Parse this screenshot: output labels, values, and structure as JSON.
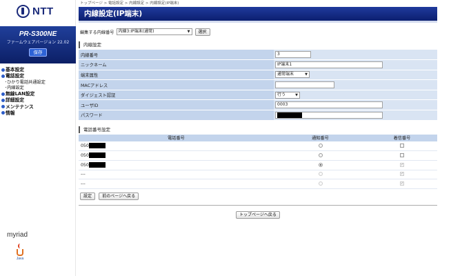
{
  "sidebar": {
    "logo_text": "NTT",
    "model_name": "PR-S300NE",
    "firmware_label": "ファームウェアバージョン",
    "firmware_version": "22.02",
    "save_label": "保存",
    "menu": [
      {
        "label": "基本設定",
        "level": "top"
      },
      {
        "label": "電話設定",
        "level": "top"
      },
      {
        "label": "･ひかり電話共通設定",
        "level": "sub"
      },
      {
        "label": "･内線設定",
        "level": "sub"
      },
      {
        "label": "無線LAN設定",
        "level": "top"
      },
      {
        "label": "詳細設定",
        "level": "top"
      },
      {
        "label": "メンテナンス",
        "level": "top"
      },
      {
        "label": "情報",
        "level": "top"
      }
    ],
    "brand_text": "myriad",
    "java_text": "Java"
  },
  "breadcrumb": "トップページ > 電話設定 > 内線設定 > 内線設定(IP端末)",
  "page_title": "内線設定(IP端末)",
  "extension_select": {
    "label": "編集する内線番号",
    "selected": "内線3:IP端末(通常)",
    "button_label": "選択"
  },
  "extension_section": {
    "title": "内線設定",
    "fields": [
      {
        "label": "内線番号",
        "type": "input",
        "value": "3"
      },
      {
        "label": "ニックネーム",
        "type": "input",
        "value": "IP端末1"
      },
      {
        "label": "端末属性",
        "type": "select",
        "value": "通常端末"
      },
      {
        "label": "MACアドレス",
        "type": "input",
        "value": ""
      },
      {
        "label": "ダイジェスト認証",
        "type": "select",
        "value": "行う"
      },
      {
        "label": "ユーザID",
        "type": "input",
        "value": "0003"
      },
      {
        "label": "パスワード",
        "type": "masked",
        "value": ""
      }
    ]
  },
  "phone_section": {
    "title": "電話番号設定",
    "columns": [
      "電話番号",
      "通知番号",
      "着信番号"
    ],
    "rows": [
      {
        "number": "050",
        "masked": true,
        "notify": "radio-off",
        "incoming": "check-off"
      },
      {
        "number": "050",
        "masked": true,
        "notify": "radio-off",
        "incoming": "check-off"
      },
      {
        "number": "050",
        "masked": true,
        "notify": "radio-on",
        "incoming": "check-on-disabled"
      },
      {
        "number": "---",
        "masked": false,
        "notify": "radio-disabled",
        "incoming": "check-on-disabled"
      },
      {
        "number": "---",
        "masked": false,
        "notify": "radio-disabled",
        "incoming": "check-on-disabled"
      }
    ]
  },
  "buttons": {
    "apply_label": "設定",
    "back_label": "前のページへ戻る",
    "top_label": "トップページへ戻る"
  },
  "colors": {
    "title_bar": "#1f3a9c",
    "key_cell": "#c3d4ec",
    "value_cell": "#d9e4f3"
  }
}
